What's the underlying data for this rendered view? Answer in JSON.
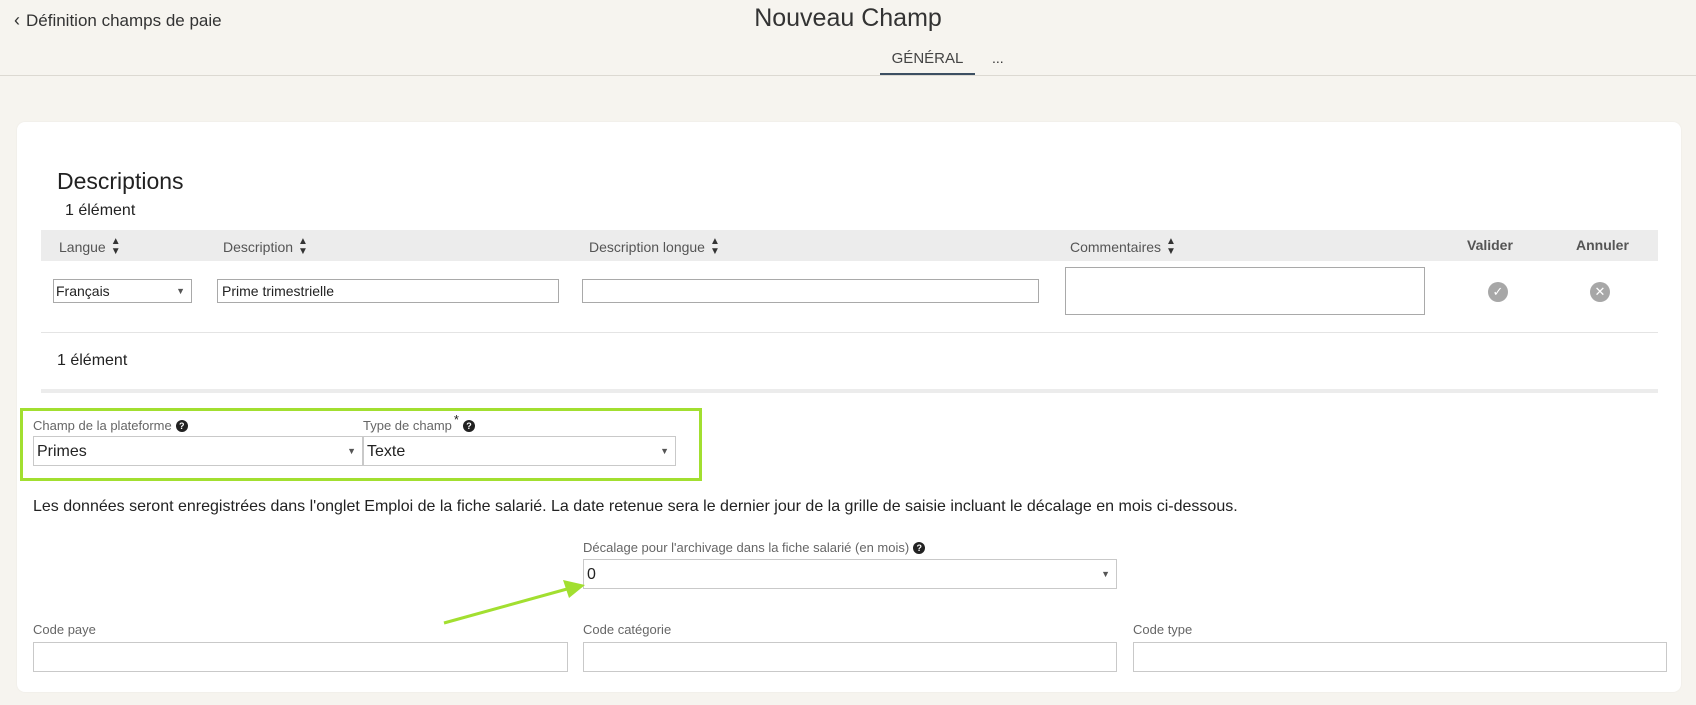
{
  "header": {
    "back_label": "Définition champs de paie",
    "title": "Nouveau Champ",
    "tabs": [
      "GÉNÉRAL",
      "..."
    ]
  },
  "descriptions": {
    "title": "Descriptions",
    "count_top": "1 élément",
    "count_bottom": "1 élément",
    "columns": {
      "langue": "Langue",
      "description": "Description",
      "description_longue": "Description longue",
      "commentaires": "Commentaires",
      "valider": "Valider",
      "annuler": "Annuler"
    },
    "row": {
      "langue": "Français",
      "description": "Prime trimestrielle",
      "description_longue": "",
      "commentaires": ""
    }
  },
  "fields": {
    "champ_plateforme_label": "Champ de la plateforme",
    "champ_plateforme_value": "Primes",
    "type_champ_label": "Type de champ",
    "type_champ_required": "*",
    "type_champ_value": "Texte",
    "info_text": "Les données seront enregistrées dans l'onglet Emploi de la fiche salarié. La date retenue sera le dernier jour de la grille de saisie incluant le décalage en mois ci-dessous.",
    "decalage_label": "Décalage pour l'archivage dans la fiche salarié (en mois)",
    "decalage_value": "0",
    "code_paye_label": "Code paye",
    "code_categorie_label": "Code catégorie",
    "code_type_label": "Code type"
  },
  "colors": {
    "highlight": "#a2df30",
    "tab_underline": "#3c4f62",
    "background": "#f6f4ef"
  },
  "icons": {
    "back": "chevron-left-icon",
    "sort": "sort-icon",
    "valider": "check-circle-icon",
    "annuler": "x-circle-icon",
    "help": "question-circle-icon"
  }
}
